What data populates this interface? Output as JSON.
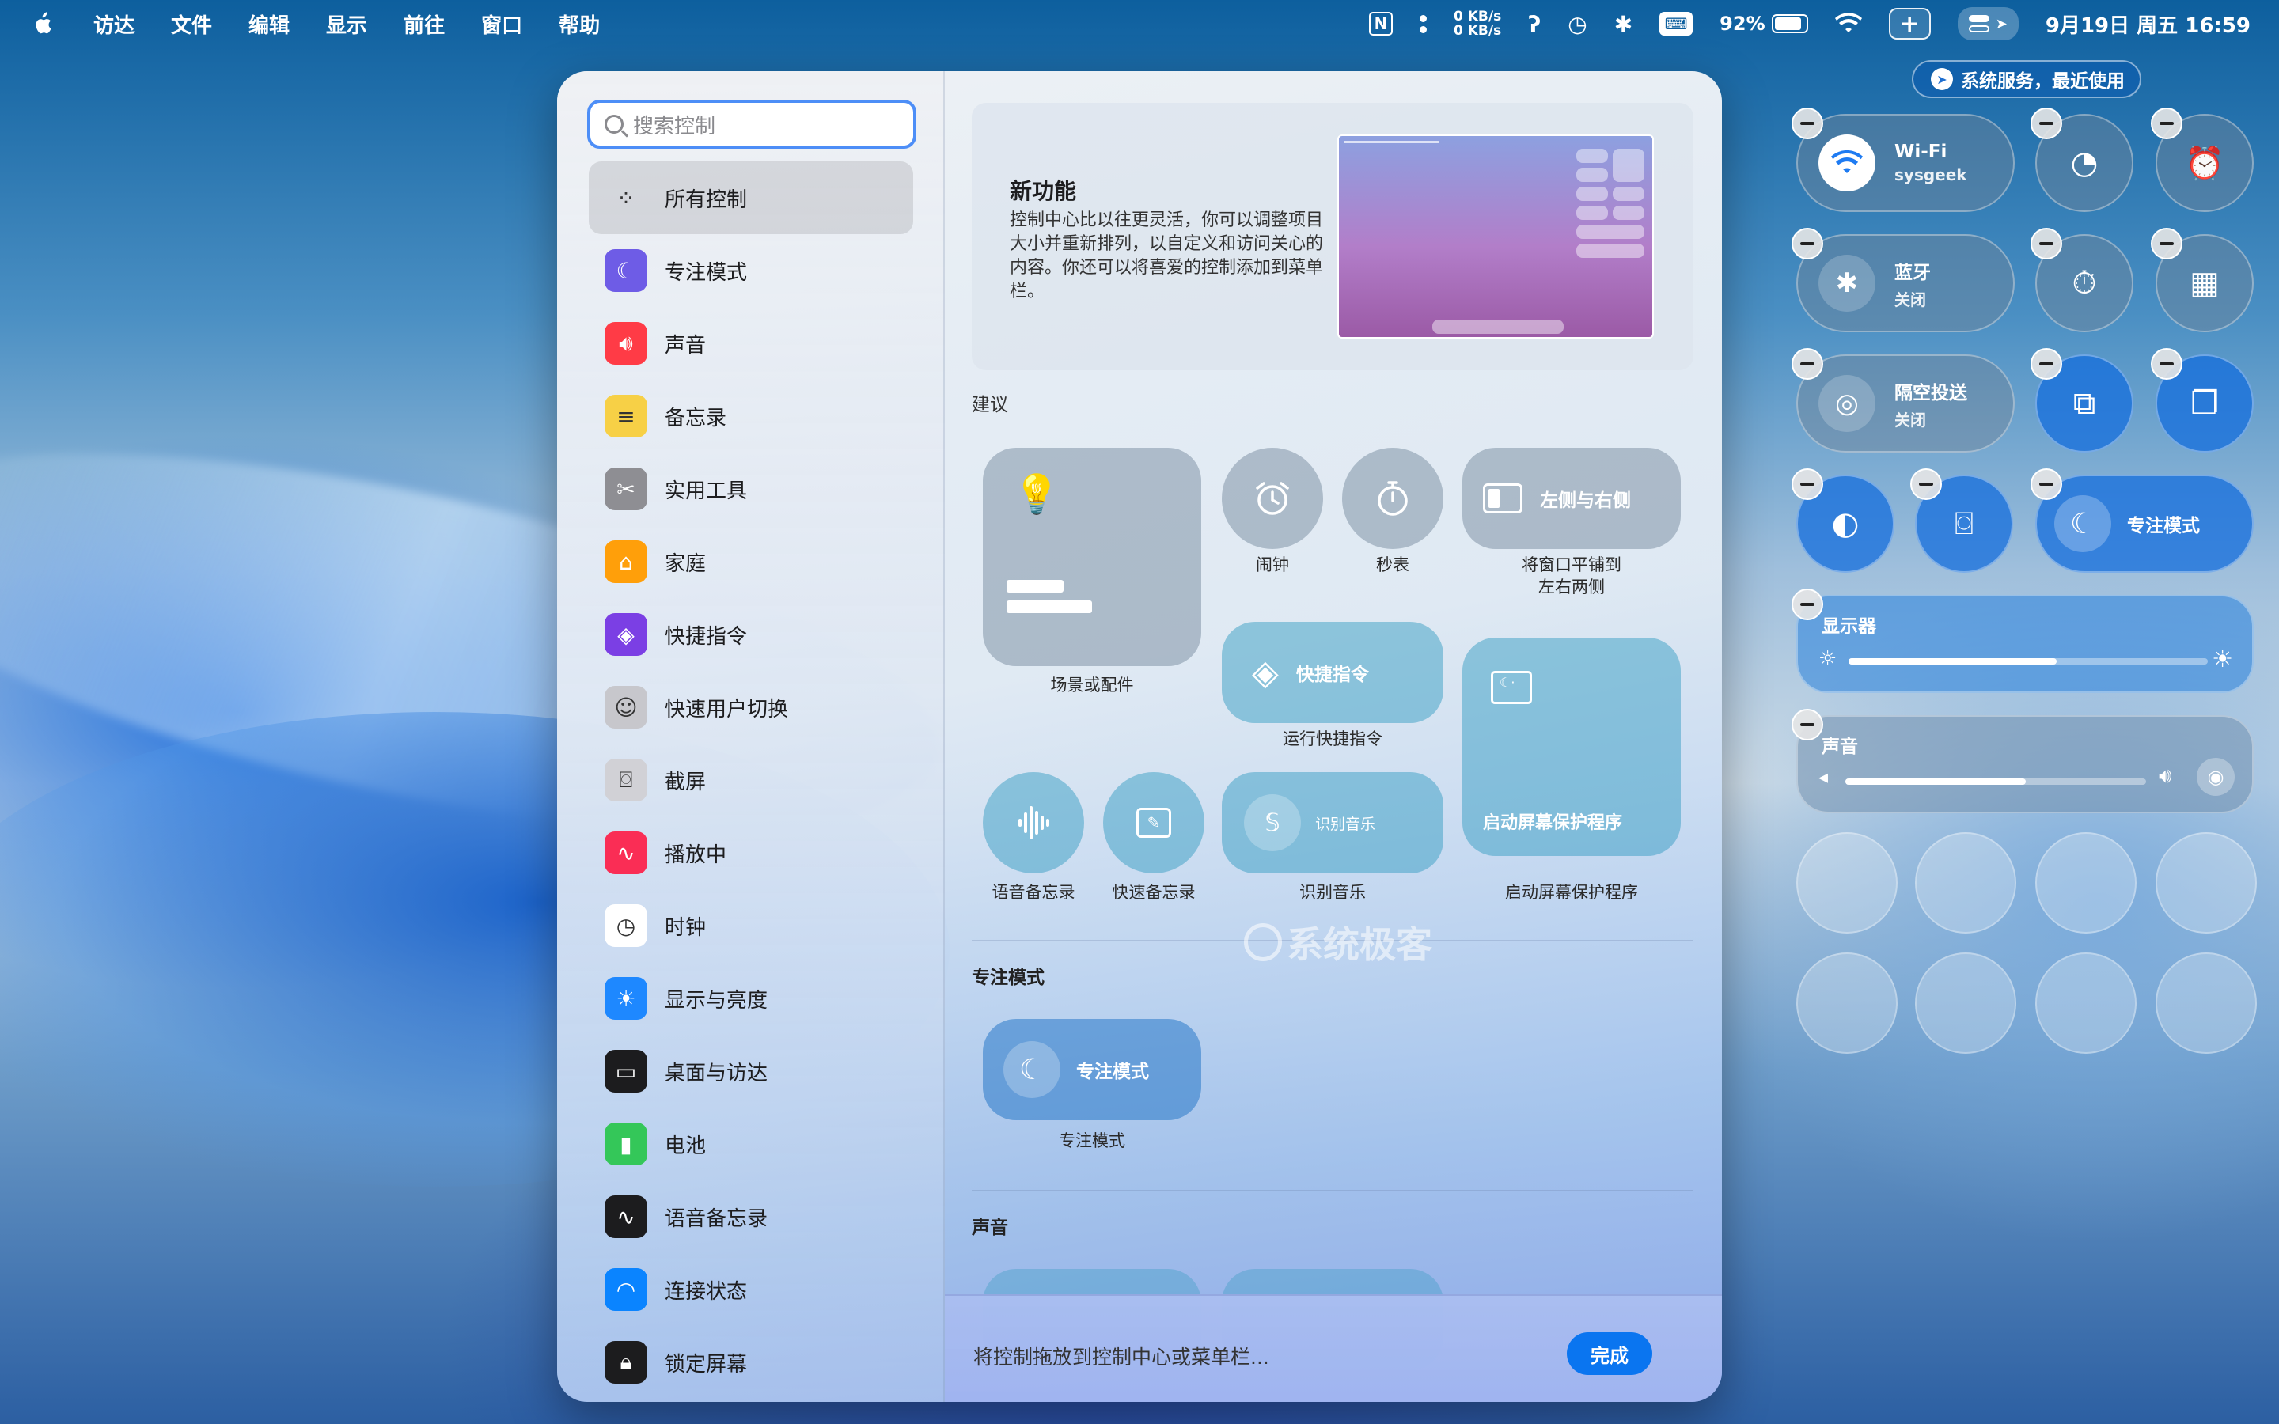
{
  "menubar": {
    "app_menus": [
      "访达",
      "文件",
      "编辑",
      "显示",
      "前往",
      "窗口",
      "帮助"
    ],
    "net_up": "0 KB/s",
    "net_down": "0 KB/s",
    "battery": "92%",
    "clock": "9月19日 周五  16:59"
  },
  "sidebar": {
    "search_placeholder": "搜索控制",
    "items": [
      {
        "label": "所有控制",
        "icon": "grid-icon",
        "color": "#00000000"
      },
      {
        "label": "专注模式",
        "icon": "moon-icon",
        "color": "#6e5ce6"
      },
      {
        "label": "声音",
        "icon": "speaker-icon",
        "color": "#ff3b46"
      },
      {
        "label": "备忘录",
        "icon": "notes-icon",
        "color": "#f7d046"
      },
      {
        "label": "实用工具",
        "icon": "tools-icon",
        "color": "#8e8e93"
      },
      {
        "label": "家庭",
        "icon": "home-icon",
        "color": "#ff9f0a"
      },
      {
        "label": "快捷指令",
        "icon": "shortcuts-icon",
        "color": "#7b3fe4"
      },
      {
        "label": "快速用户切换",
        "icon": "user-icon",
        "color": "#c7c7cc"
      },
      {
        "label": "截屏",
        "icon": "screenshot-icon",
        "color": "#d1d1d6"
      },
      {
        "label": "播放中",
        "icon": "waveform-icon",
        "color": "#fa2d55"
      },
      {
        "label": "时钟",
        "icon": "clock-icon",
        "color": "#ffffff"
      },
      {
        "label": "显示与亮度",
        "icon": "sun-icon",
        "color": "#1e88ff"
      },
      {
        "label": "桌面与访达",
        "icon": "desktop-icon",
        "color": "#1c1c1e"
      },
      {
        "label": "电池",
        "icon": "battery-icon",
        "color": "#34c759"
      },
      {
        "label": "语音备忘录",
        "icon": "voice-memo-icon",
        "color": "#1c1c1e"
      },
      {
        "label": "连接状态",
        "icon": "wifi-icon",
        "color": "#0a84ff"
      },
      {
        "label": "锁定屏幕",
        "icon": "lock-icon",
        "color": "#1c1c1e"
      }
    ]
  },
  "banner": {
    "title": "新功能",
    "body": "控制中心比以往更灵活，你可以调整项目大小并重新排列，以自定义和访问关心的内容。你还可以将喜爱的控制添加到菜单栏。"
  },
  "suggestions": {
    "section_label": "建议",
    "scene_caption": "场景或配件",
    "alarm_caption": "闹钟",
    "stopwatch_caption": "秒表",
    "tile_left_right_label": "左侧与右侧",
    "tile_left_right_caption": "将窗口平铺到\n左右两侧",
    "shortcuts_label": "快捷指令",
    "shortcuts_caption": "运行快捷指令",
    "screensaver_label": "启动屏幕保护程序",
    "screensaver_caption": "启动屏幕保护程序",
    "voice_memo_caption": "语音备忘录",
    "quick_note_caption": "快速备忘录",
    "recognize_music_label": "识别音乐",
    "recognize_music_caption": "识别音乐"
  },
  "focus_section": {
    "section_label": "专注模式",
    "tile_label": "专注模式",
    "caption": "专注模式"
  },
  "sound_section": {
    "section_label": "声音"
  },
  "footer": {
    "hint": "将控制拖放到控制中心或菜单栏...",
    "done_label": "完成"
  },
  "control_center": {
    "privacy_tag": "系统服务，最近使用",
    "wifi": {
      "title": "Wi-Fi",
      "subtitle": "sysgeek"
    },
    "bluetooth": {
      "title": "蓝牙",
      "subtitle": "关闭"
    },
    "airdrop": {
      "title": "隔空投送",
      "subtitle": "关闭"
    },
    "focus": {
      "title": "专注模式"
    },
    "display": {
      "title": "显示器",
      "level": 0.58
    },
    "sound": {
      "title": "声音",
      "level": 0.6
    }
  },
  "watermark": "系统极客"
}
